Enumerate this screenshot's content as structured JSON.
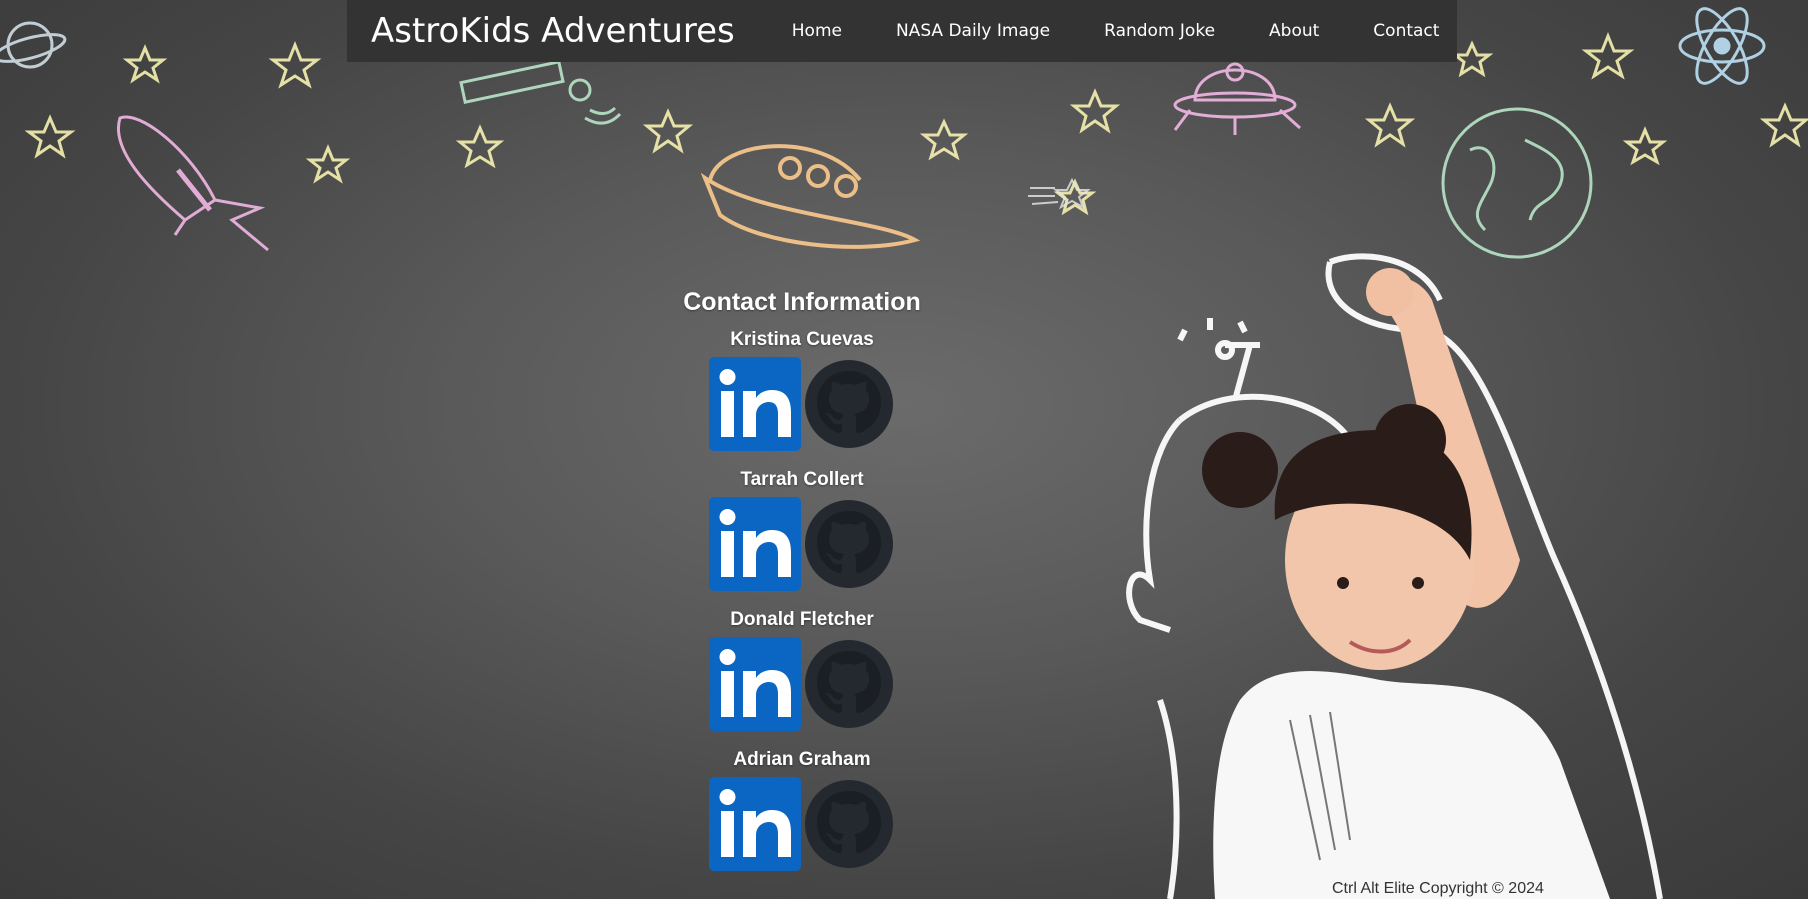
{
  "nav": {
    "brand": "AstroKids Adventures",
    "links": [
      "Home",
      "NASA Daily Image",
      "Random Joke",
      "About",
      "Contact"
    ]
  },
  "contact": {
    "title": "Contact Information",
    "members": [
      {
        "name": "Kristina Cuevas"
      },
      {
        "name": "Tarrah Collert"
      },
      {
        "name": "Donald Fletcher"
      },
      {
        "name": "Adrian Graham"
      }
    ],
    "icons": [
      "linkedin-icon",
      "github-icon"
    ]
  },
  "footer": {
    "text": "Ctrl Alt Elite Copyright © 2024"
  },
  "colors": {
    "navbar": "#333333",
    "linkedin": "#0a66c2",
    "github": "#24292f",
    "chalkboard": "#555555"
  }
}
